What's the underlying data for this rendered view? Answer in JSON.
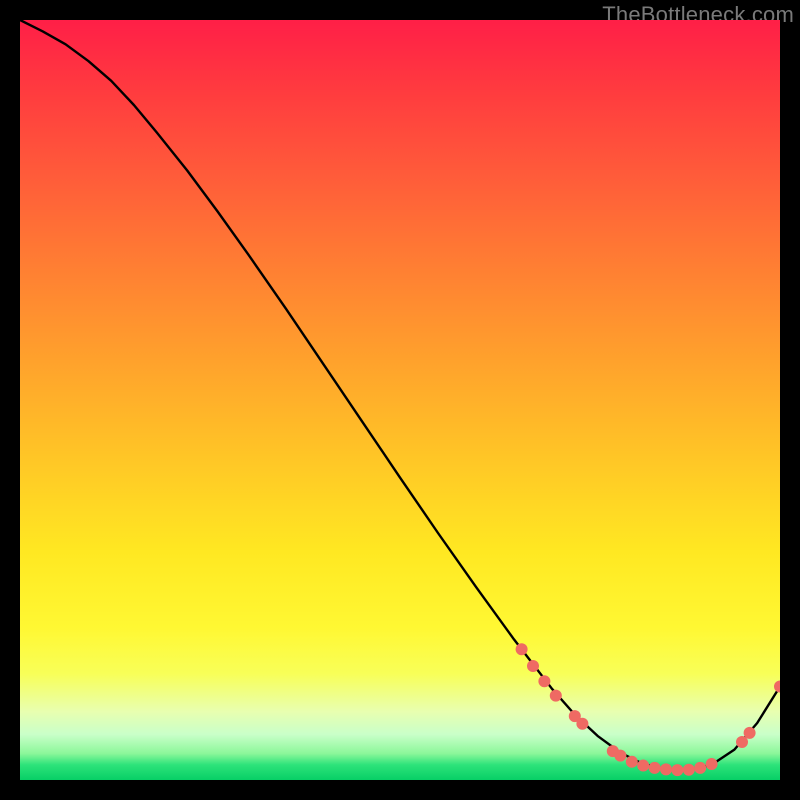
{
  "watermark": "TheBottleneck.com",
  "chart_data": {
    "type": "line",
    "title": "",
    "xlabel": "",
    "ylabel": "",
    "xlim": [
      0,
      100
    ],
    "ylim": [
      0,
      100
    ],
    "grid": false,
    "legend": false,
    "series": [
      {
        "name": "bottleneck-curve",
        "x": [
          0,
          3,
          6,
          9,
          12,
          15,
          18,
          22,
          26,
          30,
          35,
          40,
          45,
          50,
          55,
          60,
          65,
          70,
          73,
          76,
          79,
          82,
          85,
          88,
          91,
          94,
          97,
          100
        ],
        "y": [
          100,
          98.5,
          96.8,
          94.6,
          92,
          88.8,
          85.2,
          80.2,
          74.8,
          69.2,
          62,
          54.6,
          47.2,
          39.8,
          32.5,
          25.4,
          18.5,
          12,
          8.6,
          5.8,
          3.6,
          2.1,
          1.4,
          1.3,
          2,
          4,
          7.5,
          12.3
        ]
      }
    ],
    "highlight_points": {
      "name": "marker-dots",
      "color": "#ef6a63",
      "radius": 6,
      "points": [
        {
          "x": 66,
          "y": 17.2
        },
        {
          "x": 67.5,
          "y": 15.0
        },
        {
          "x": 69,
          "y": 13.0
        },
        {
          "x": 70.5,
          "y": 11.1
        },
        {
          "x": 73,
          "y": 8.4
        },
        {
          "x": 74,
          "y": 7.4
        },
        {
          "x": 78,
          "y": 3.8
        },
        {
          "x": 79,
          "y": 3.2
        },
        {
          "x": 80.5,
          "y": 2.4
        },
        {
          "x": 82,
          "y": 1.9
        },
        {
          "x": 83.5,
          "y": 1.6
        },
        {
          "x": 85,
          "y": 1.4
        },
        {
          "x": 86.5,
          "y": 1.3
        },
        {
          "x": 88,
          "y": 1.35
        },
        {
          "x": 89.5,
          "y": 1.6
        },
        {
          "x": 91,
          "y": 2.1
        },
        {
          "x": 95,
          "y": 5.0
        },
        {
          "x": 96,
          "y": 6.2
        },
        {
          "x": 100,
          "y": 12.3
        }
      ]
    }
  }
}
